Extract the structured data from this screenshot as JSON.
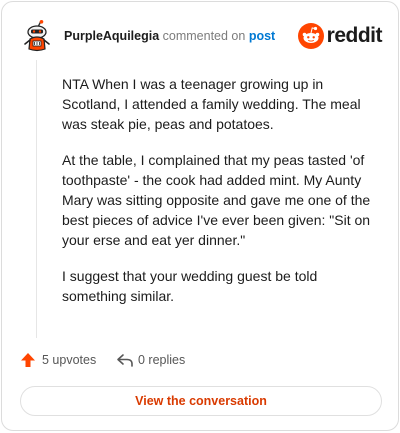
{
  "header": {
    "username": "PurpleAquilegia",
    "action": "commented on",
    "post_link": "post",
    "brand": "reddit",
    "avatar_icon": "snoo-avatar-icon",
    "brand_color": "#ff4500"
  },
  "comment": {
    "paragraphs": [
      "NTA When I was a teenager growing up in Scotland, I attended a family wedding. The meal was steak pie, peas and potatoes.",
      "At the table, I complained that my peas tasted 'of toothpaste' - the cook had added mint. My Aunty Mary was sitting opposite and gave me one of the best pieces of advice I've ever been given: \"Sit on your erse and eat yer dinner.\"",
      "I suggest that your wedding guest be told something similar."
    ]
  },
  "footer": {
    "upvotes": "5 upvotes",
    "replies": "0 replies",
    "upvote_icon": "upvote-arrow-icon",
    "reply_icon": "reply-arrow-icon",
    "upvote_color": "#ff4500"
  },
  "cta": {
    "label": "View the conversation",
    "color": "#d93a00"
  }
}
